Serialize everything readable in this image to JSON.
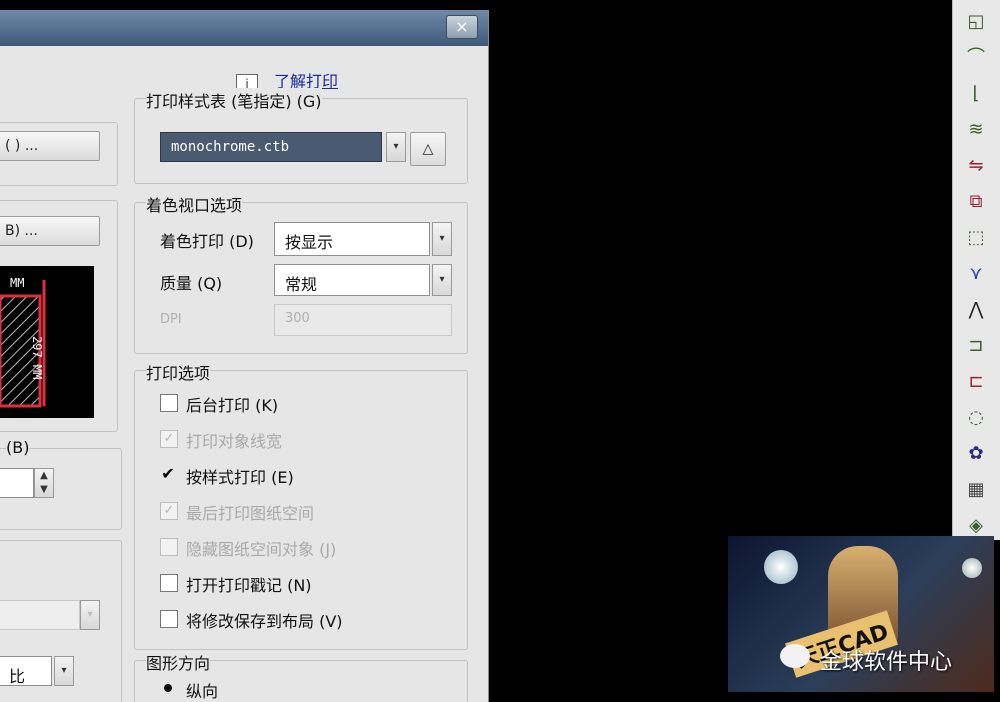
{
  "dialog": {
    "close_glyph": "×",
    "info_glyph": "i",
    "help_link": "了解打印",
    "left": {
      "button1": "( ) ...",
      "button2": "B) ...",
      "preview_label_top": "MM",
      "preview_label_side": "297 MM",
      "label_b": "(B)",
      "combo_bottom": "比"
    },
    "plot_style": {
      "title": "打印样式表 (笔指定) (G)",
      "selected": "monochrome.ctb"
    },
    "shaded": {
      "title": "着色视口选项",
      "shade_label": "着色打印 (D)",
      "shade_value": "按显示",
      "quality_label": "质量 (Q)",
      "quality_value": "常规",
      "dpi_label": "DPI",
      "dpi_value": "300"
    },
    "options": {
      "title": "打印选项",
      "items": [
        {
          "label": "后台打印 (K)",
          "state": "unchecked",
          "enabled": true
        },
        {
          "label": "打印对象线宽",
          "state": "checked",
          "enabled": false
        },
        {
          "label": "按样式打印 (E)",
          "state": "checked",
          "enabled": true
        },
        {
          "label": "最后打印图纸空间",
          "state": "checked",
          "enabled": false
        },
        {
          "label": "隐藏图纸空间对象 (J)",
          "state": "unchecked",
          "enabled": false
        },
        {
          "label": "打开打印戳记 (N)",
          "state": "unchecked",
          "enabled": true
        },
        {
          "label": "将修改保存到布局 (V)",
          "state": "unchecked",
          "enabled": true
        }
      ]
    },
    "orientation": {
      "title": "图形方向",
      "portrait": "纵向"
    }
  },
  "toolbar": {
    "icons": [
      "rect-icon",
      "arc-icon",
      "polyline-icon",
      "spline-icon",
      "mirror-icon",
      "copy-icon",
      "stretch-icon",
      "trim-icon",
      "extend-icon",
      "break-icon",
      "join-icon",
      "fillet-icon",
      "array-icon",
      "hatch-icon",
      "explode-icon"
    ]
  },
  "watermark": {
    "banner_text": "天正CAD",
    "channel": "金球软件中心"
  },
  "colors": {
    "dialog_bg": "#e6e6e6",
    "titlebar": "#4f6a88",
    "link": "#1a2a9a",
    "plot_style_bg": "#4a5a70"
  }
}
